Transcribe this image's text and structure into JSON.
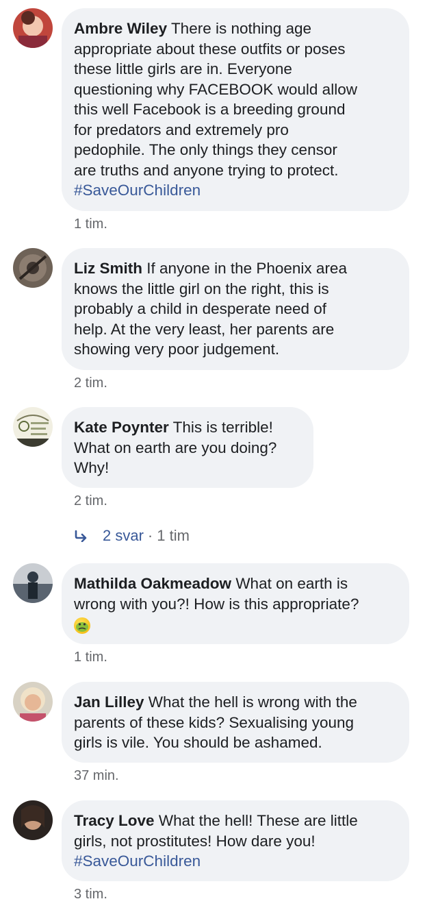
{
  "comments": [
    {
      "author": "Ambre Wiley",
      "text_lines": [
        " There is nothing age",
        "appropriate about these outfits or poses",
        "these little girls are in. Everyone",
        "questioning why FACEBOOK would allow",
        "this well Facebook is a breeding ground",
        "for predators and extremely pro",
        "pedophile. The only things they censor",
        "are truths and anyone trying to protect."
      ],
      "hashtag": "#SaveOurChildren",
      "time": "1 tim."
    },
    {
      "author": "Liz Smith",
      "text_lines": [
        " If anyone in the Phoenix area",
        "knows the little girl on the right, this is",
        "probably a child in desperate need of",
        "help. At the very least, her parents are",
        "showing very poor judgement."
      ],
      "time": "2 tim."
    },
    {
      "author": "Kate Poynter",
      "text_lines": [
        " This is terrible!",
        "What on earth are you doing?",
        "Why!"
      ],
      "time": "2 tim."
    },
    {
      "author": "Mathilda Oakmeadow",
      "text_lines": [
        " What on earth is",
        "wrong with you?! How is this appropriate?"
      ],
      "emoji": "sick-face-emoji",
      "time": "1 tim."
    },
    {
      "author": "Jan Lilley",
      "text_lines": [
        " What the hell is wrong with the",
        "parents of these kids? Sexualising young",
        "girls is vile. You should be ashamed."
      ],
      "time": "37 min."
    },
    {
      "author": "Tracy Love",
      "text_lines": [
        " What the hell! These are little",
        "girls, not prostitutes! How dare you!"
      ],
      "hashtag": "#SaveOurChildren",
      "time": "3 tim."
    }
  ],
  "replies": {
    "label": "2 svar",
    "separator": "·",
    "time": "1 tim",
    "icon": "reply-arrow-icon"
  },
  "colors": {
    "bubble": "#f0f2f5",
    "link": "#385898",
    "meta": "#65676b",
    "text": "#1c1e21"
  }
}
